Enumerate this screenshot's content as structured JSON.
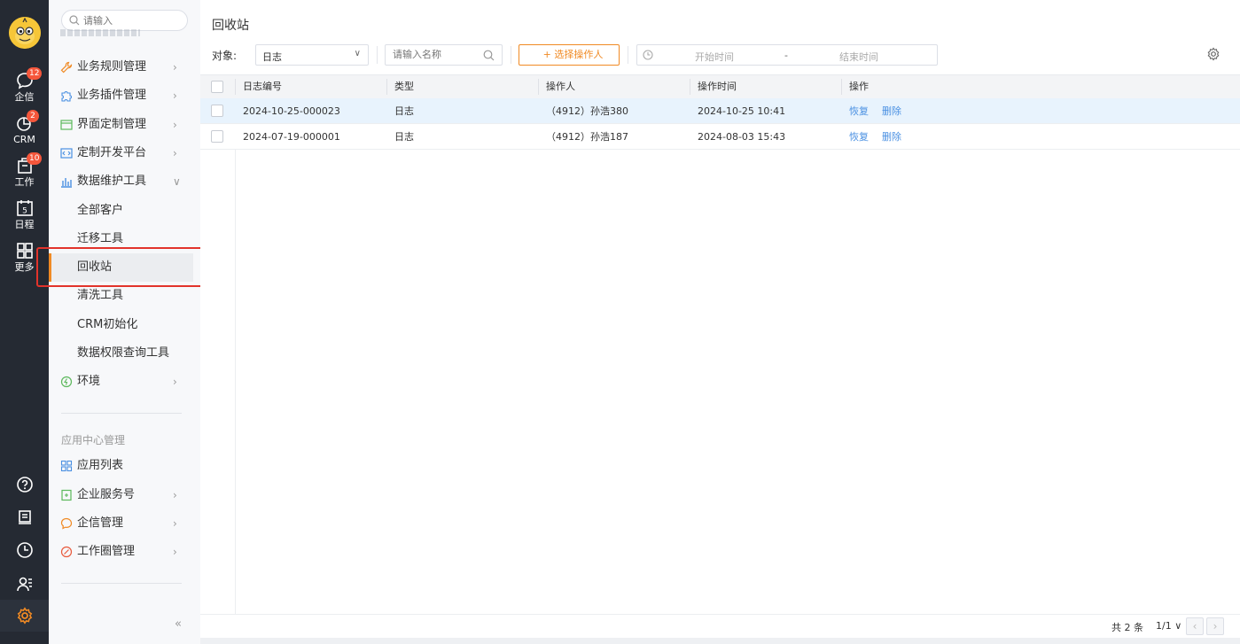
{
  "rail": {
    "items": [
      {
        "label": "企信",
        "badge": "12",
        "icon": "chat-bubble-icon"
      },
      {
        "label": "CRM",
        "badge": "2",
        "icon": "pie-chart-icon"
      },
      {
        "label": "工作",
        "badge": "10",
        "icon": "briefcase-icon"
      },
      {
        "label": "日程",
        "badge": "",
        "icon": "calendar-icon",
        "day": "5"
      },
      {
        "label": "更多",
        "badge": "",
        "icon": "grid-icon"
      }
    ],
    "bottom_icons": [
      "help-icon",
      "notice-icon",
      "clock-icon",
      "contacts-icon",
      "settings-gear-icon"
    ]
  },
  "sidebar": {
    "search_placeholder": "请输入",
    "items": [
      {
        "label": "业务规则管理",
        "icon": "wrench-icon"
      },
      {
        "label": "业务插件管理",
        "icon": "puzzle-icon"
      },
      {
        "label": "界面定制管理",
        "icon": "layout-icon"
      },
      {
        "label": "定制开发平台",
        "icon": "code-icon"
      },
      {
        "label": "数据维护工具",
        "icon": "bar-chart-icon"
      }
    ],
    "sub_items": [
      "全部客户",
      "迁移工具",
      "回收站",
      "清洗工具",
      "CRM初始化",
      "数据权限查询工具"
    ],
    "env_label": "环境",
    "section_title": "应用中心管理",
    "app_items": [
      {
        "label": "应用列表",
        "icon": "app-grid-icon"
      },
      {
        "label": "企业服务号",
        "icon": "service-icon"
      },
      {
        "label": "企信管理",
        "icon": "message-icon"
      },
      {
        "label": "工作圈管理",
        "icon": "circle-icon"
      }
    ],
    "collapse_label": "«"
  },
  "main": {
    "title": "回收站",
    "filter": {
      "object_label": "对象:",
      "object_value": "日志",
      "name_placeholder": "请输入名称",
      "operator_button": "+ 选择操作人",
      "start_placeholder": "开始时间",
      "dash": "-",
      "end_placeholder": "结束时间"
    },
    "table": {
      "headers": [
        "日志编号",
        "类型",
        "操作人",
        "操作时间",
        "操作"
      ],
      "rows": [
        {
          "id": "2024-10-25-000023",
          "type": "日志",
          "operator": "（4912）孙浩380",
          "time": "2024-10-25 10:41",
          "restore": "恢复",
          "delete": "删除"
        },
        {
          "id": "2024-07-19-000001",
          "type": "日志",
          "operator": "（4912）孙浩187",
          "time": "2024-08-03 15:43",
          "restore": "恢复",
          "delete": "删除"
        }
      ]
    },
    "pagination": {
      "total": "共 2 条",
      "page": "1/1 ∨",
      "prev": "‹",
      "next": "›"
    }
  },
  "colors": {
    "accent": "#f08a24",
    "link": "#4a90e2",
    "rail_bg": "#252a33",
    "highlight_row": "#e8f3fd",
    "annotation_box": "#e2332b"
  }
}
